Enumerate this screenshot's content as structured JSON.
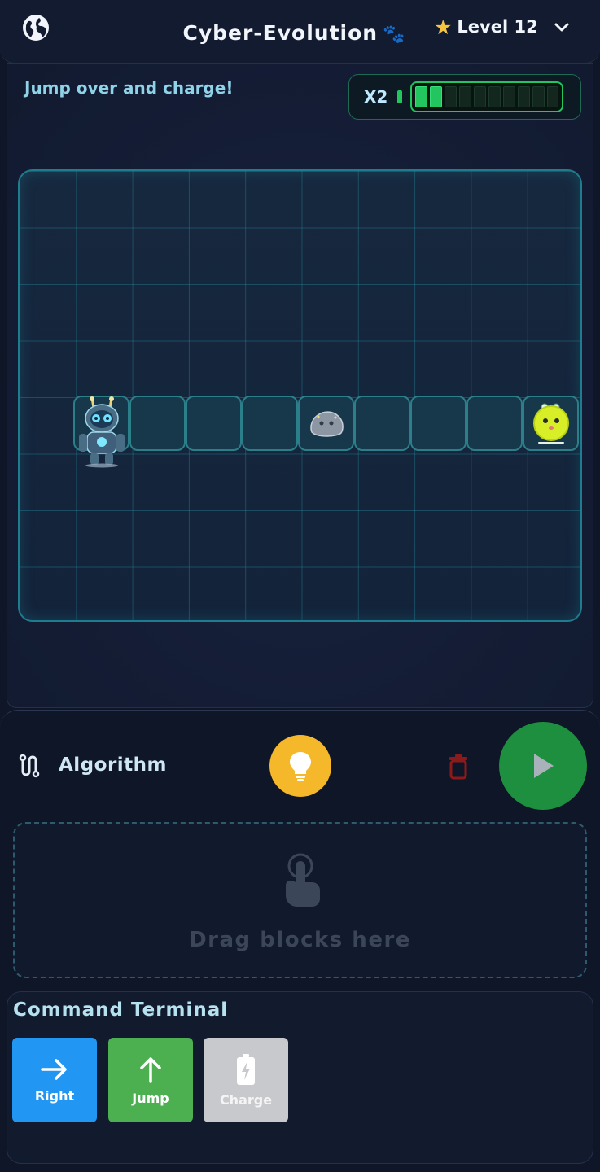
{
  "header": {
    "title": "Cyber-Evolution",
    "level_label": "Level 12"
  },
  "mission": {
    "text": "Jump over and charge!",
    "multiplier": "X2",
    "energy_fraction": 0.2
  },
  "board": {
    "columns": 10,
    "rows": 8,
    "path_tiles": 9
  },
  "algorithm": {
    "title": "Algorithm",
    "drop_hint": "Drag blocks here"
  },
  "terminal": {
    "title": "Command Terminal",
    "commands": [
      {
        "label": "Right",
        "icon": "arrow-right-icon"
      },
      {
        "label": "Jump",
        "icon": "arrow-up-icon"
      },
      {
        "label": "Charge",
        "icon": "battery-charge-icon"
      }
    ]
  },
  "colors": {
    "accent_cyan": "#1f7c8c",
    "energy_green": "#22c55e",
    "play_green": "#1e8f3e",
    "hint_yellow": "#f4b82a",
    "right_blue": "#2196f3",
    "jump_green": "#4caf50",
    "charge_grey": "#c7c9cc"
  }
}
